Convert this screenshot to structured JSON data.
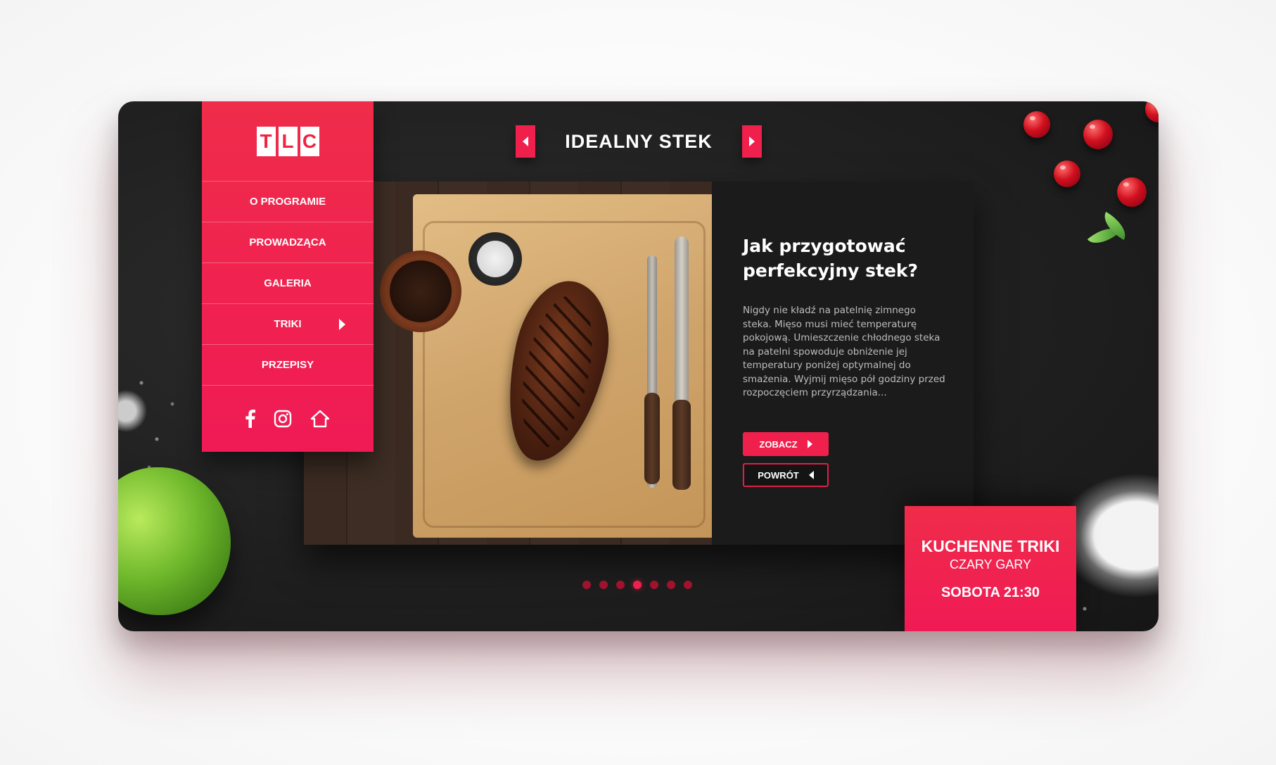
{
  "brand": {
    "logo_letters": [
      "T",
      "L",
      "C"
    ],
    "accent_color": "#f0204d"
  },
  "sidebar": {
    "items": [
      {
        "label": "O PROGRAMIE",
        "has_submenu": false
      },
      {
        "label": "PROWADZĄCA",
        "has_submenu": false
      },
      {
        "label": "GALERIA",
        "has_submenu": false
      },
      {
        "label": "TRIKI",
        "has_submenu": true
      },
      {
        "label": "PRZEPISY",
        "has_submenu": false
      }
    ],
    "social_icons": [
      "facebook-icon",
      "instagram-icon",
      "home-icon"
    ]
  },
  "slider": {
    "title": "IDEALNY STEK",
    "prev_icon": "chevron-left-icon",
    "next_icon": "chevron-right-icon",
    "dots_total": 7,
    "active_dot": 4
  },
  "article": {
    "heading": "Jak przygotować perfekcyjny stek?",
    "body": "Nigdy nie kładź na patelnię zimnego steka. Mięso musi mieć temperaturę pokojową. Umieszczenie chłodnego steka na patelni spowoduje obniżenie jej temperatury poniżej optymalnej do smażenia. Wyjmij mięso pół godziny przed rozpoczęciem przyrządzania...",
    "see_button": "ZOBACZ",
    "back_button": "POWRÓT"
  },
  "promo": {
    "title": "KUCHENNE TRIKI",
    "subtitle": "CZARY GARY",
    "schedule": "SOBOTA 21:30"
  }
}
